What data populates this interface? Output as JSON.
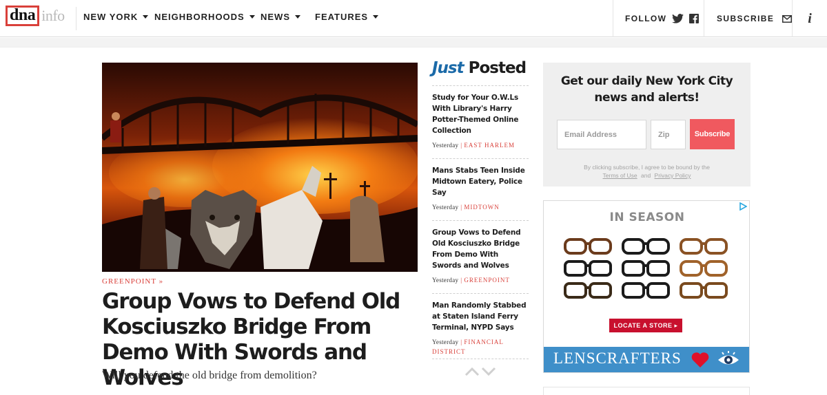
{
  "header": {
    "logo": {
      "primary": "dna",
      "secondary": "info"
    },
    "nav": [
      {
        "label": "NEW YORK",
        "dropdown": true
      },
      {
        "label": "NEIGHBORHOODS",
        "dropdown": true
      },
      {
        "label": "NEWS",
        "dropdown": true
      },
      {
        "label": "FEATURES",
        "dropdown": true
      }
    ],
    "follow_label": "FOLLOW",
    "subscribe_label": "SUBSCRIBE",
    "info_label": "i"
  },
  "hero": {
    "neighborhood": "GREENPOINT »",
    "title": "Group Vows to Defend Old Kosciuszko Bridge From Demo With Swords and Wolves",
    "dek": "Will you defend the old bridge from demolition?"
  },
  "just_posted": {
    "heading_italic": "Just",
    "heading_bold": "Posted",
    "items": [
      {
        "title": "Study for Your O.W.Ls With Library's Harry Potter-Themed Online Collection",
        "time": "Yesterday",
        "neighborhood": "EAST HARLEM"
      },
      {
        "title": "Mans Stabs Teen Inside Midtown Eatery, Police Say",
        "time": "Yesterday",
        "neighborhood": "MIDTOWN"
      },
      {
        "title": "Group Vows to Defend Old Kosciuszko Bridge From Demo With Swords and Wolves",
        "time": "Yesterday",
        "neighborhood": "GREENPOINT"
      },
      {
        "title": "Man Randomly Stabbed at Staten Island Ferry Terminal, NYPD Says",
        "time": "Yesterday",
        "neighborhood": "FINANCIAL DISTRICT"
      }
    ]
  },
  "newsletter": {
    "title": "Get our daily New York City news and alerts!",
    "email_placeholder": "Email Address",
    "zip_placeholder": "Zip",
    "button": "Subscribe",
    "legal_prefix": "By clicking subscribe, I agree to be bound by the",
    "terms": "Terms of Use",
    "and": "and",
    "privacy": "Privacy Policy"
  },
  "ad": {
    "headline": "IN SEASON",
    "cta": "LOCATE A STORE ▸",
    "brand": "LensCrafters"
  },
  "colors": {
    "accent_red": "#d9403a",
    "just_blue": "#1b6aa8",
    "subscribe_button": "#f0595f",
    "ad_blue": "#3f8fc9",
    "ad_red": "#c8102e"
  },
  "icons": {
    "twitter": "twitter-icon",
    "facebook": "facebook-icon",
    "mail": "mail-icon",
    "info": "info-icon",
    "arrows": [
      "chevron-up-icon",
      "chevron-down-icon"
    ]
  }
}
